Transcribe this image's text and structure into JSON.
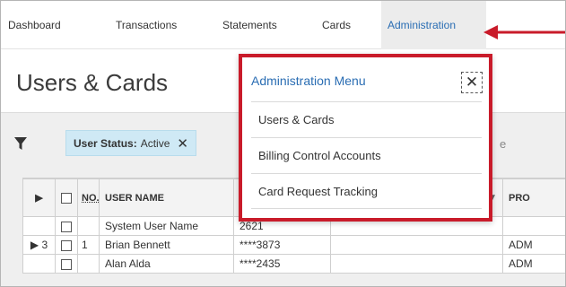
{
  "nav": {
    "items": [
      {
        "label": "Dashboard"
      },
      {
        "label": "Transactions"
      },
      {
        "label": "Statements"
      },
      {
        "label": "Cards"
      },
      {
        "label": "Administration"
      }
    ],
    "active_index": 4
  },
  "page": {
    "title": "Users & Cards"
  },
  "filter": {
    "icon": "funnel-icon",
    "chip_key": "User Status:",
    "chip_value": "Active",
    "chip_remove": "✕",
    "behind_text": "e"
  },
  "menu": {
    "title": "Administration Menu",
    "close_glyph": "✕",
    "items": [
      {
        "label": "Users & Cards"
      },
      {
        "label": "Billing Control Accounts"
      },
      {
        "label": "Card Request Tracking"
      }
    ]
  },
  "table": {
    "columns": [
      {
        "label": "▶"
      },
      {
        "label": ""
      },
      {
        "label": "NO."
      },
      {
        "label": "USER NAME"
      },
      {
        "label": ""
      },
      {
        "label": "▼"
      },
      {
        "label": "PRO"
      }
    ],
    "rows": [
      {
        "expander": "",
        "no": "",
        "name": "System User Name",
        "card": "2621",
        "extra": "",
        "pro": ""
      },
      {
        "expander": "▶ 3",
        "no": "1",
        "name": "Brian Bennett",
        "card": "****3873",
        "extra": "",
        "pro": "ADM"
      },
      {
        "expander": "",
        "no": "",
        "name": "Alan Alda",
        "card": "****2435",
        "extra": "",
        "pro": "ADM"
      }
    ]
  },
  "colors": {
    "accent_blue": "#2a6db3",
    "highlight_red": "#c91b2a",
    "chip_bg": "#cfe9f5"
  }
}
